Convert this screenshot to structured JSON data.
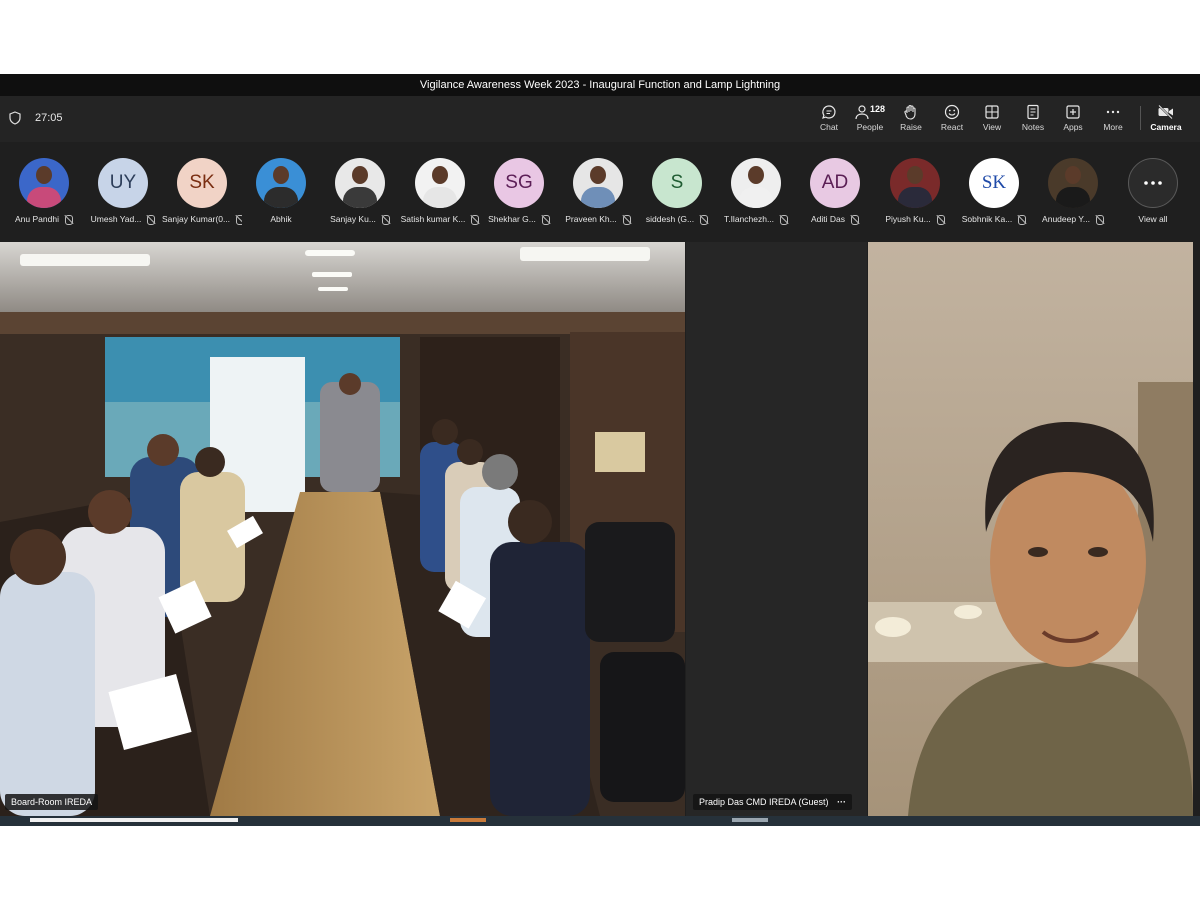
{
  "window": {
    "title": "Vigilance Awareness Week 2023 - Inaugural Function and Lamp Lightning"
  },
  "toolbar": {
    "timer": "27:05",
    "people_count": "128",
    "buttons": [
      {
        "label": "Chat",
        "icon": "chat-icon"
      },
      {
        "label": "People",
        "icon": "people-icon"
      },
      {
        "label": "Raise",
        "icon": "raise-hand-icon"
      },
      {
        "label": "React",
        "icon": "react-icon"
      },
      {
        "label": "View",
        "icon": "view-icon"
      },
      {
        "label": "Notes",
        "icon": "notes-icon"
      },
      {
        "label": "Apps",
        "icon": "apps-icon"
      },
      {
        "label": "More",
        "icon": "more-icon"
      },
      {
        "label": "Camera",
        "icon": "camera-off-icon"
      }
    ]
  },
  "participants": [
    {
      "name": "Anu Pandhi",
      "initials": "",
      "type": "photo"
    },
    {
      "name": "Umesh Yad...",
      "initials": "UY",
      "type": "initials",
      "bg": "#c7d4e8",
      "fg": "#2d3e5a"
    },
    {
      "name": "Sanjay Kumar(0...",
      "initials": "SK",
      "type": "initials",
      "bg": "#f1d3c6",
      "fg": "#7a2e12"
    },
    {
      "name": "Abhik",
      "initials": "",
      "type": "photo"
    },
    {
      "name": "Sanjay Ku...",
      "initials": "",
      "type": "photo"
    },
    {
      "name": "Satish kumar K...",
      "initials": "",
      "type": "photo"
    },
    {
      "name": "Shekhar G...",
      "initials": "SG",
      "type": "initials",
      "bg": "#e9c7e4",
      "fg": "#5c1f57"
    },
    {
      "name": "Praveen Kh...",
      "initials": "",
      "type": "photo"
    },
    {
      "name": "siddesh (G...",
      "initials": "S",
      "type": "initials",
      "bg": "#c8e6cf",
      "fg": "#1f5c32"
    },
    {
      "name": "T.Ilanchezh...",
      "initials": "",
      "type": "photo"
    },
    {
      "name": "Aditi Das",
      "initials": "AD",
      "type": "initials",
      "bg": "#e8c9e3",
      "fg": "#5a1e54"
    },
    {
      "name": "Piyush Ku...",
      "initials": "",
      "type": "photo"
    },
    {
      "name": "Sobhnik Ka...",
      "initials": "SK",
      "type": "initials",
      "bg": "#ffffff",
      "fg": "#1f4aa8"
    },
    {
      "name": "Anudeep Y...",
      "initials": "",
      "type": "photo"
    }
  ],
  "view_all": {
    "label": "View all"
  },
  "tiles": {
    "main_label": "Board-Room IREDA",
    "second_label": "Pradip Das CMD IREDA (Guest)"
  }
}
